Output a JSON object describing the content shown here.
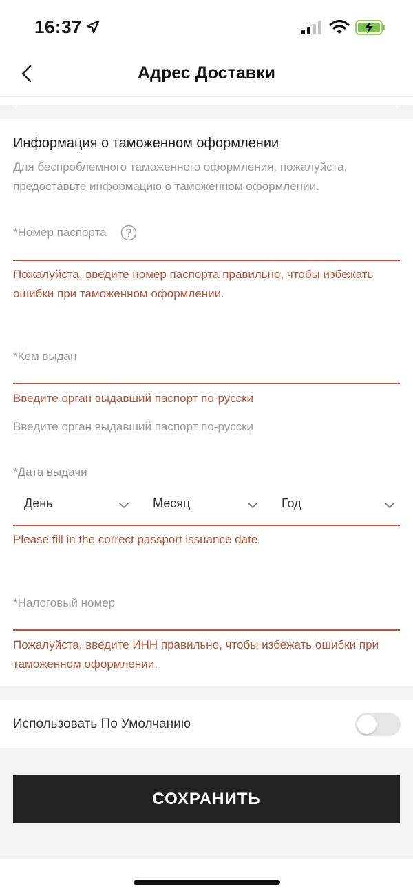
{
  "status_bar": {
    "time": "16:37",
    "icons": [
      "location-arrow-icon",
      "cellular-signal-icon",
      "wifi-icon",
      "battery-charging-icon"
    ]
  },
  "header": {
    "title": "Адрес Доставки",
    "back_icon": "chevron-left-icon"
  },
  "customs": {
    "title": "Информация о таможенном оформлении",
    "description": "Для беспроблемного таможенного оформления, пожалуйста, предоставьте информацию о таможенном оформлении."
  },
  "passport_number": {
    "label": "*Номер паспорта",
    "help_icon": "question-circle-icon",
    "value": "",
    "error": "Пожалуйста, введите номер паспорта правильно, чтобы избежать ошибки при таможенном оформлении."
  },
  "issued_by": {
    "label": "*Кем выдан",
    "value": "",
    "error": "Введите орган выдавший паспорт по-русски",
    "hint": "Введите орган выдавший паспорт по-русски"
  },
  "issue_date": {
    "label": "*Дата выдачи",
    "day": "День",
    "month": "Месяц",
    "year": "Год",
    "error": "Please fill in the correct passport issuance date"
  },
  "tax_number": {
    "label": "*Налоговый номер",
    "value": "",
    "error": "Пожалуйста, введите ИНН правильно, чтобы избежать ошибки при таможенном оформлении."
  },
  "default_option": {
    "label": "Использовать По Умолчанию",
    "enabled": false
  },
  "save_button": {
    "label": "СОХРАНИТЬ"
  },
  "colors": {
    "error": "#b5553a",
    "button": "#222222",
    "muted_text": "#9a9a9a"
  }
}
